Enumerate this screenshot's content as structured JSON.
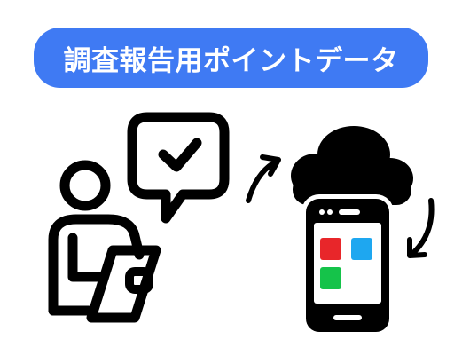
{
  "title": "調査報告用ポイントデータ",
  "icons": {
    "person": "person-with-clipboard-icon",
    "speech": "speech-bubble-check-icon",
    "arrow_up": "curved-arrow-up-icon",
    "cloud": "cloud-icon",
    "phone": "smartphone-icon",
    "arrow_down": "curved-arrow-down-icon"
  },
  "colors": {
    "pill": "#3f7af3",
    "tile_red": "#e8262a",
    "tile_blue": "#1ea7f0",
    "tile_green": "#15c34a",
    "ink": "#000000"
  }
}
